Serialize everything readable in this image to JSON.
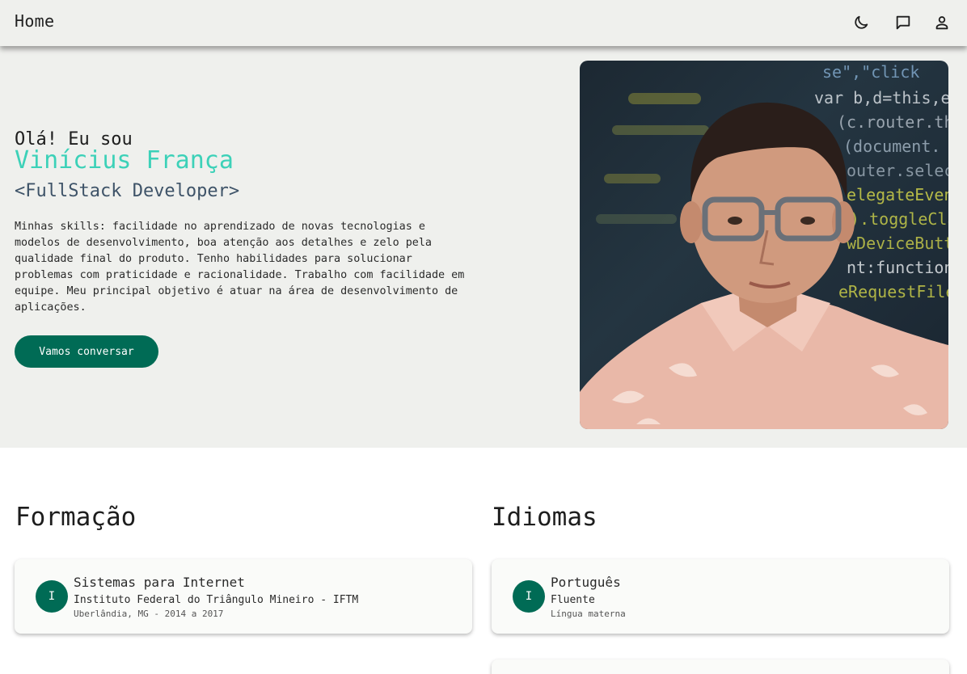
{
  "header": {
    "title": "Home",
    "icons": [
      "moon-icon",
      "chat-icon",
      "person-icon"
    ]
  },
  "hero": {
    "greeting": "Olá! Eu sou",
    "name": "Vinícius França",
    "role": "<FullStack Developer>",
    "bio": "Minhas skills: facilidade no aprendizado de novas tecnologias e modelos de desenvolvimento, boa atenção aos detalhes e zelo pela qualidade final do produto. Tenho habilidades para solucionar problemas com praticidade e racionalidade. Trabalho com facilidade em equipe. Meu principal objetivo é atuar na área de desenvolvimento de aplicações.",
    "cta_label": "Vamos conversar",
    "photo_code_lines": [
      "se\",\"click",
      "var b,d=this,e=this",
      "(c.router.themePa",
      "(document.",
      "outer.selecte",
      "elegateEvents",
      "}).toggleClass",
      "wDeviceButtons",
      "nt:function",
      "eRequestFilesyste"
    ]
  },
  "education": {
    "title": "Formação",
    "items": [
      {
        "avatar": "I",
        "title": "Sistemas para Internet",
        "institution": "Instituto Federal do Triângulo Mineiro - IFTM",
        "meta": "Uberlândia, MG - 2014 a 2017"
      }
    ]
  },
  "languages": {
    "title": "Idiomas",
    "items": [
      {
        "avatar": "I",
        "title": "Português",
        "level": "Fluente",
        "meta": "Língua materna"
      }
    ]
  },
  "colors": {
    "accent": "#006b55",
    "name_highlight": "#3cd1b8",
    "role_text": "#3e5368",
    "hero_bg": "#eff0ed"
  }
}
